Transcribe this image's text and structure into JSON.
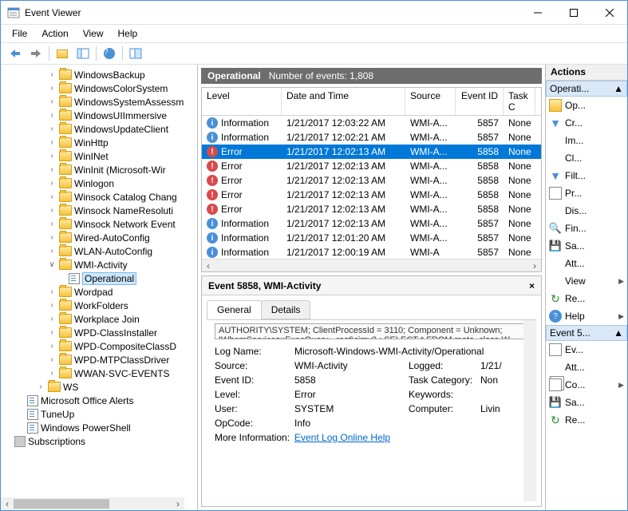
{
  "window": {
    "title": "Event Viewer"
  },
  "menu": {
    "file": "File",
    "action": "Action",
    "view": "View",
    "help": "Help"
  },
  "tree": {
    "items": [
      "WindowsBackup",
      "WindowsColorSystem",
      "WindowsSystemAssessm",
      "WindowsUIImmersive",
      "WindowsUpdateClient",
      "WinHttp",
      "WinINet",
      "WinInit (Microsoft-Wir",
      "Winlogon",
      "Winsock Catalog Chang",
      "Winsock NameResoluti",
      "Winsock Network Event",
      "Wired-AutoConfig",
      "WLAN-AutoConfig"
    ],
    "wmi": "WMI-Activity",
    "operational": "Operational",
    "items2": [
      "Wordpad",
      "WorkFolders",
      "Workplace Join",
      "WPD-ClassInstaller",
      "WPD-CompositeClassD",
      "WPD-MTPClassDriver",
      "WWAN-SVC-EVENTS"
    ],
    "ws": "WS",
    "bottom": [
      "Microsoft Office Alerts",
      "TuneUp",
      "Windows PowerShell"
    ],
    "subs": "Subscriptions"
  },
  "op": {
    "title": "Operational",
    "count_label": "Number of events: 1,808",
    "cols": {
      "level": "Level",
      "dt": "Date and Time",
      "src": "Source",
      "eid": "Event ID",
      "tc": "Task C"
    },
    "rows": [
      {
        "t": "info",
        "level": "Information",
        "dt": "1/21/2017 12:03:22 AM",
        "src": "WMI-A...",
        "eid": "5857",
        "tc": "None"
      },
      {
        "t": "info",
        "level": "Information",
        "dt": "1/21/2017 12:02:21 AM",
        "src": "WMI-A...",
        "eid": "5857",
        "tc": "None"
      },
      {
        "t": "err",
        "level": "Error",
        "dt": "1/21/2017 12:02:13 AM",
        "src": "WMI-A...",
        "eid": "5858",
        "tc": "None",
        "sel": true
      },
      {
        "t": "err",
        "level": "Error",
        "dt": "1/21/2017 12:02:13 AM",
        "src": "WMI-A...",
        "eid": "5858",
        "tc": "None"
      },
      {
        "t": "err",
        "level": "Error",
        "dt": "1/21/2017 12:02:13 AM",
        "src": "WMI-A...",
        "eid": "5858",
        "tc": "None"
      },
      {
        "t": "err",
        "level": "Error",
        "dt": "1/21/2017 12:02:13 AM",
        "src": "WMI-A...",
        "eid": "5858",
        "tc": "None"
      },
      {
        "t": "err",
        "level": "Error",
        "dt": "1/21/2017 12:02:13 AM",
        "src": "WMI-A...",
        "eid": "5858",
        "tc": "None"
      },
      {
        "t": "info",
        "level": "Information",
        "dt": "1/21/2017 12:02:13 AM",
        "src": "WMI-A...",
        "eid": "5857",
        "tc": "None"
      },
      {
        "t": "info",
        "level": "Information",
        "dt": "1/21/2017 12:01:20 AM",
        "src": "WMI-A...",
        "eid": "5857",
        "tc": "None"
      },
      {
        "t": "info",
        "level": "Information",
        "dt": "1/21/2017 12:00:19 AM",
        "src": "WMI-A",
        "eid": "5857",
        "tc": "None"
      }
    ]
  },
  "detail": {
    "title": "Event 5858, WMI-Activity",
    "tabs": {
      "general": "General",
      "details": "Details"
    },
    "desc": "AUTHORITY\\SYSTEM; ClientProcessId = 3110; Component = Unknown; IWbemServices::ExecQuery - root\\cimv2 : SELECT * FROM meta_class W",
    "props": {
      "logname_l": "Log Name:",
      "logname_v": "Microsoft-Windows-WMI-Activity/Operational",
      "source_l": "Source:",
      "source_v": "WMI-Activity",
      "logged_l": "Logged:",
      "logged_v": "1/21/",
      "eid_l": "Event ID:",
      "eid_v": "5858",
      "tc_l": "Task Category:",
      "tc_v": "Non",
      "level_l": "Level:",
      "level_v": "Error",
      "kw_l": "Keywords:",
      "kw_v": "",
      "user_l": "User:",
      "user_v": "SYSTEM",
      "comp_l": "Computer:",
      "comp_v": "Livin",
      "op_l": "OpCode:",
      "op_v": "Info",
      "more_l": "More Information:",
      "more_v": "Event Log Online Help"
    }
  },
  "actions": {
    "hdr": "Actions",
    "s1": "Operati...",
    "i1": [
      "Op...",
      "Cr...",
      "Im...",
      "Cl...",
      "Filt...",
      "Pr...",
      "Dis...",
      "Fin...",
      "Sa...",
      "Att...",
      "View",
      "Re...",
      "Help"
    ],
    "s2": "Event 5...",
    "i2": [
      "Ev...",
      "Att...",
      "Co...",
      "Sa...",
      "Re..."
    ]
  }
}
